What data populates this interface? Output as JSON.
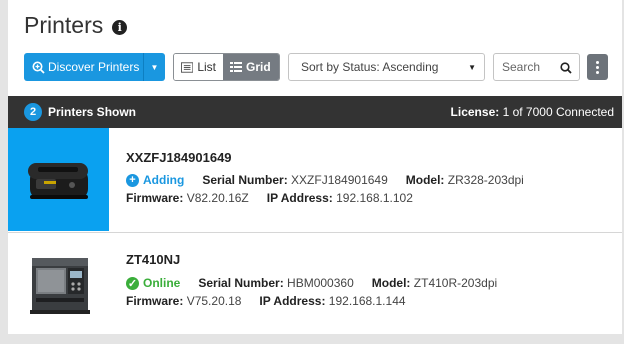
{
  "header": {
    "title": "Printers"
  },
  "toolbar": {
    "discover_label": "Discover Printers",
    "view_list_label": "List",
    "view_grid_label": "Grid",
    "sort_value": "Sort by Status: Ascending",
    "search_placeholder": "Search"
  },
  "statusbar": {
    "count": "2",
    "shown_label": "Printers Shown",
    "license_label": "License:",
    "license_value": "1 of 7000 Connected"
  },
  "printers": [
    {
      "name": "XXZFJ184901649",
      "status": "Adding",
      "serial_label": "Serial Number:",
      "serial": "XXZFJ184901649",
      "model_label": "Model:",
      "model": "ZR328-203dpi",
      "firmware_label": "Firmware:",
      "firmware": "V82.20.16Z",
      "ip_label": "IP Address:",
      "ip": "192.168.1.102"
    },
    {
      "name": "ZT410NJ",
      "status": "Online",
      "serial_label": "Serial Number:",
      "serial": "HBM000360",
      "model_label": "Model:",
      "model": "ZT410R-203dpi",
      "firmware_label": "Firmware:",
      "firmware": "V75.20.18",
      "ip_label": "IP Address:",
      "ip": "192.168.1.144"
    }
  ],
  "colors": {
    "accent": "#1a97e0",
    "online": "#3aae3a",
    "header_bar": "#333333",
    "selected_thumb": "#0aa1f0"
  },
  "icons": {
    "info": "info-icon",
    "discover": "search-plus-icon",
    "list": "list-icon",
    "grid": "grid-icon",
    "search": "search-icon",
    "more": "kebab-menu-icon",
    "adding": "plus-circle-icon",
    "online": "check-circle-icon"
  }
}
